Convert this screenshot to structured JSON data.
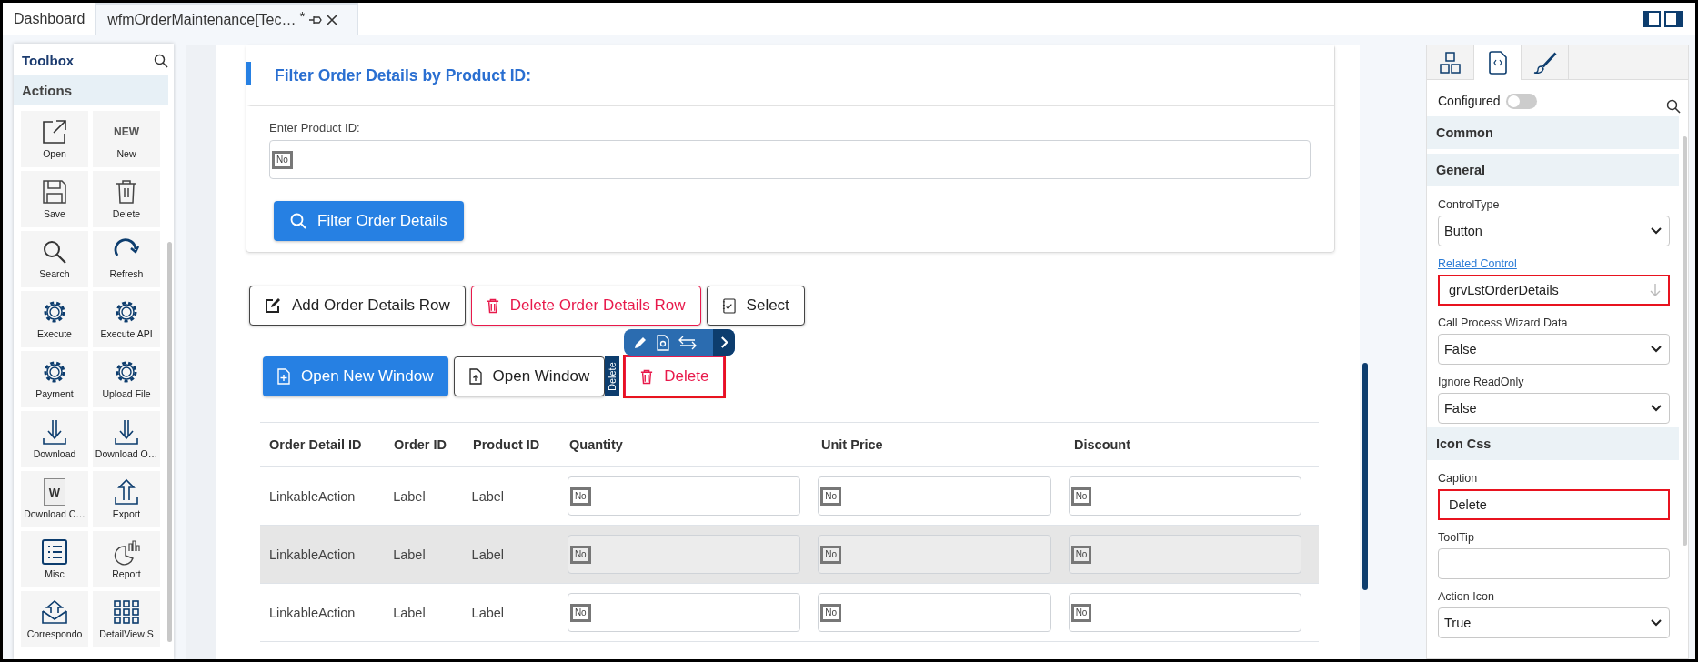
{
  "tabs": [
    {
      "label": "Dashboard",
      "selected": false,
      "modified": false
    },
    {
      "label": "wfmOrderMaintenance[Tec…",
      "selected": true,
      "modified": true,
      "modified_mark": "*"
    }
  ],
  "toolbox": {
    "title": "Toolbox",
    "section": "Actions",
    "new_icon_text": "NEW",
    "items": [
      {
        "label": "Open",
        "kind": "open"
      },
      {
        "label": "New",
        "kind": "text"
      },
      {
        "label": "Save",
        "kind": "save"
      },
      {
        "label": "Delete",
        "kind": "trash"
      },
      {
        "label": "Search",
        "kind": "search"
      },
      {
        "label": "Refresh",
        "kind": "refresh"
      },
      {
        "label": "Execute",
        "kind": "gear"
      },
      {
        "label": "Execute API",
        "kind": "gear"
      },
      {
        "label": "Payment",
        "kind": "gear"
      },
      {
        "label": "Upload File",
        "kind": "gear"
      },
      {
        "label": "Download",
        "kind": "download"
      },
      {
        "label": "Download O…",
        "kind": "download"
      },
      {
        "label": "Download C…",
        "kind": "word",
        "icon_text": "W"
      },
      {
        "label": "Export",
        "kind": "export"
      },
      {
        "label": "Misc",
        "kind": "list"
      },
      {
        "label": "Report",
        "kind": "report"
      },
      {
        "label": "Correspondo",
        "kind": "mail"
      },
      {
        "label": "DetailView S",
        "kind": "grid"
      }
    ]
  },
  "filter_card": {
    "title": "Filter Order Details by Product ID:",
    "field_label": "Enter Product ID:",
    "field_image_text": "No",
    "button": "Filter Order Details"
  },
  "action_buttons": [
    {
      "label": "Add Order Details Row",
      "kind": "edit"
    },
    {
      "label": "Delete Order Details Row",
      "kind": "delete"
    },
    {
      "label": "Select",
      "kind": "select"
    }
  ],
  "window_buttons": [
    {
      "label": "Open New Window",
      "kind": "primary",
      "selected": false
    },
    {
      "label": "Open Window",
      "kind": "outline",
      "selected": false
    },
    {
      "label": "Delete",
      "kind": "delete",
      "selected": true
    }
  ],
  "selection_tag": "Delete",
  "table": {
    "columns": [
      "Order Detail ID",
      "Order ID",
      "Product ID",
      "Quantity",
      "Unit Price",
      "Discount"
    ],
    "rows": [
      {
        "cells": [
          "LinkableAction",
          "Label",
          "Label"
        ],
        "inputs": [
          "No",
          "No",
          "No"
        ],
        "disabled": false
      },
      {
        "cells": [
          "LinkableAction",
          "Label",
          "Label"
        ],
        "inputs": [
          "No",
          "No",
          "No"
        ],
        "disabled": true
      },
      {
        "cells": [
          "LinkableAction",
          "Label",
          "Label"
        ],
        "inputs": [
          "No",
          "No",
          "No"
        ],
        "disabled": false
      }
    ]
  },
  "properties": {
    "tabs": [
      {
        "kind": "blocks",
        "selected": false
      },
      {
        "kind": "code",
        "selected": true
      },
      {
        "kind": "brush",
        "selected": false
      }
    ],
    "configured": {
      "label": "Configured",
      "on": false
    },
    "items": [
      {
        "kind": "section",
        "title": "Common"
      },
      {
        "kind": "section",
        "title": "General"
      },
      {
        "kind": "select",
        "label": "ControlType",
        "value": "Button",
        "highlighted": false
      },
      {
        "kind": "lookup",
        "label": "Related Control",
        "value": "grvLstOrderDetails",
        "highlighted": true
      },
      {
        "kind": "select",
        "label": "Call Process Wizard Data",
        "value": "False",
        "highlighted": false
      },
      {
        "kind": "select",
        "label": "Ignore ReadOnly",
        "value": "False",
        "highlighted": false
      },
      {
        "kind": "section",
        "title": "Icon Css"
      },
      {
        "kind": "input",
        "label": "Caption",
        "value": "Delete",
        "highlighted": true
      },
      {
        "kind": "input",
        "label": "ToolTip",
        "highlighted": false
      },
      {
        "kind": "select",
        "label": "Action Icon",
        "value": "True",
        "highlighted": false
      }
    ]
  }
}
